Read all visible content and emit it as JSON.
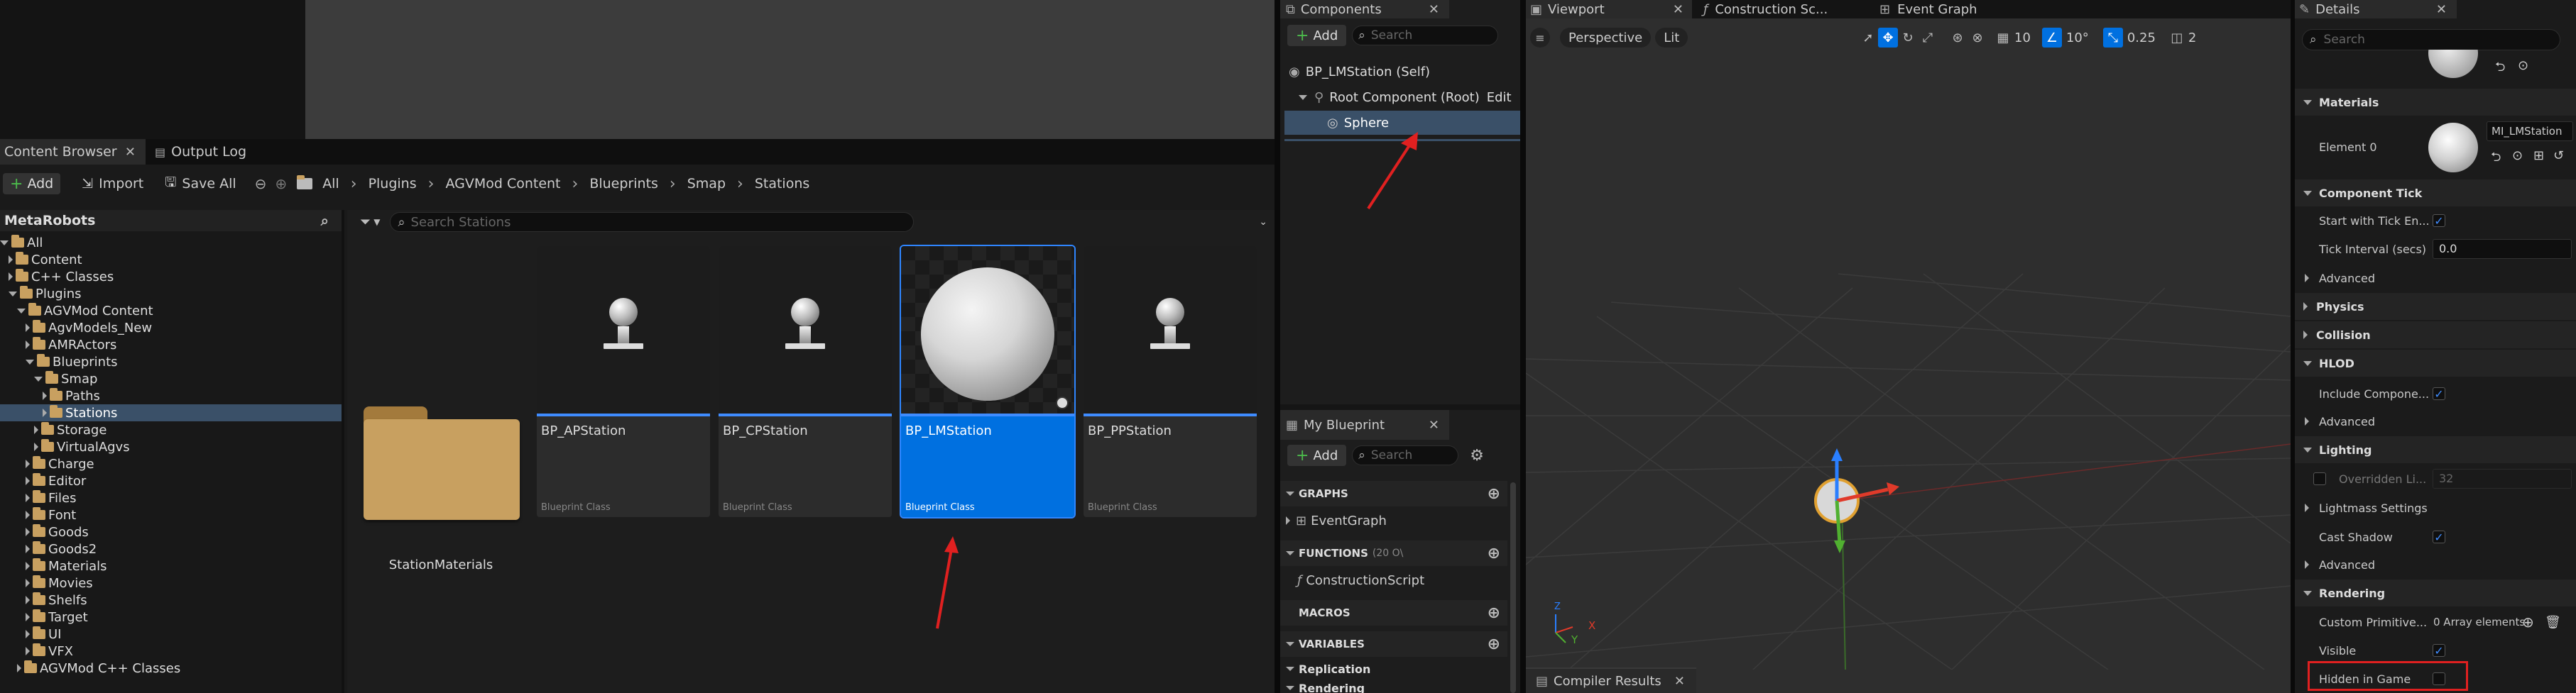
{
  "top_strip": {},
  "content_browser": {
    "tab_label": "Content Browser",
    "output_log_label": "Output Log",
    "add_label": "Add",
    "import_label": "Import",
    "save_all_label": "Save All",
    "breadcrumb": [
      "All",
      "Plugins",
      "AGVMod Content",
      "Blueprints",
      "Smap",
      "Stations"
    ],
    "search_placeholder": "Search Stations",
    "sources_title": "MetaRobots",
    "tree": [
      {
        "label": "All",
        "indent": 0,
        "expanded": true
      },
      {
        "label": "Content",
        "indent": 1,
        "expanded": false
      },
      {
        "label": "C++ Classes",
        "indent": 1,
        "expanded": false
      },
      {
        "label": "Plugins",
        "indent": 1,
        "expanded": true
      },
      {
        "label": "AGVMod Content",
        "indent": 2,
        "expanded": true
      },
      {
        "label": "AgvModels_New",
        "indent": 3,
        "expanded": false
      },
      {
        "label": "AMRActors",
        "indent": 3,
        "expanded": false
      },
      {
        "label": "Blueprints",
        "indent": 3,
        "expanded": true
      },
      {
        "label": "Smap",
        "indent": 4,
        "expanded": true
      },
      {
        "label": "Paths",
        "indent": 5,
        "expanded": false
      },
      {
        "label": "Stations",
        "indent": 5,
        "expanded": false,
        "selected": true
      },
      {
        "label": "Storage",
        "indent": 4,
        "expanded": false
      },
      {
        "label": "VirtualAgvs",
        "indent": 4,
        "expanded": false
      },
      {
        "label": "Charge",
        "indent": 3,
        "expanded": false
      },
      {
        "label": "Editor",
        "indent": 3,
        "expanded": false
      },
      {
        "label": "Files",
        "indent": 3,
        "expanded": false
      },
      {
        "label": "Font",
        "indent": 3,
        "expanded": false
      },
      {
        "label": "Goods",
        "indent": 3,
        "expanded": false
      },
      {
        "label": "Goods2",
        "indent": 3,
        "expanded": false
      },
      {
        "label": "Materials",
        "indent": 3,
        "expanded": false
      },
      {
        "label": "Movies",
        "indent": 3,
        "expanded": false
      },
      {
        "label": "Shelfs",
        "indent": 3,
        "expanded": false
      },
      {
        "label": "Target",
        "indent": 3,
        "expanded": false
      },
      {
        "label": "UI",
        "indent": 3,
        "expanded": false
      },
      {
        "label": "VFX",
        "indent": 3,
        "expanded": false
      },
      {
        "label": "AGVMod C++ Classes",
        "indent": 2,
        "expanded": false
      }
    ],
    "assets": [
      {
        "name": "StationMaterials",
        "type": "folder"
      },
      {
        "name": "BP_APStation",
        "class": "Blueprint Class",
        "selected": false
      },
      {
        "name": "BP_CPStation",
        "class": "Blueprint Class",
        "selected": false
      },
      {
        "name": "BP_LMStation",
        "class": "Blueprint Class",
        "selected": true
      },
      {
        "name": "BP_PPStation",
        "class": "Blueprint Class",
        "selected": false
      }
    ]
  },
  "components": {
    "tab_label": "Components",
    "add_label": "Add",
    "search_placeholder": "Search",
    "self_label": "BP_LMStation (Self)",
    "root_label": "Root Component (Root)",
    "edit_label": "Edit",
    "sphere_label": "Sphere"
  },
  "my_blueprint": {
    "tab_label": "My Blueprint",
    "add_label": "Add",
    "search_placeholder": "Search",
    "graphs_label": "GRAPHS",
    "event_graph_label": "EventGraph",
    "functions_label": "FUNCTIONS",
    "functions_count": "(20 O\\",
    "construction_label": "ConstructionScript",
    "macros_label": "MACROS",
    "variables_label": "VARIABLES",
    "replication_label": "Replication",
    "rendering_label": "Rendering"
  },
  "viewport": {
    "tab_viewport": "Viewport",
    "tab_construction": "Construction Sc...",
    "tab_event_graph": "Event Graph",
    "perspective_label": "Perspective",
    "lit_label": "Lit",
    "grid_value": "10",
    "rot_value": "10°",
    "scale_value": "0.25",
    "cam_speed": "2",
    "compiler_results_label": "Compiler Results",
    "axis_x": "X",
    "axis_y": "Y",
    "axis_z": "Z"
  },
  "details": {
    "tab_label": "Details",
    "search_placeholder": "Search",
    "materials_header": "Materials",
    "element0_label": "Element 0",
    "element0_value": "MI_LMStation",
    "component_tick_header": "Component Tick",
    "start_tick_label": "Start with Tick En...",
    "tick_interval_label": "Tick Interval (secs)",
    "tick_interval_value": "0.0",
    "advanced_label": "Advanced",
    "physics_label": "Physics",
    "collision_label": "Collision",
    "hlod_header": "HLOD",
    "include_component_label": "Include Compone...",
    "lighting_header": "Lighting",
    "overridden_label": "Overridden Li...",
    "overridden_value": "32",
    "lightmass_label": "Lightmass Settings",
    "cast_shadow_label": "Cast Shadow",
    "rendering_header": "Rendering",
    "custom_primitive_label": "Custom Primitive...",
    "custom_primitive_value": "0 Array elements",
    "visible_label": "Visible",
    "hidden_in_game_label": "Hidden in Game"
  },
  "colors": {
    "accent": "#3f8cff",
    "selection": "#0070e0",
    "folder": "#c8a060",
    "annotation": "#e02020"
  }
}
